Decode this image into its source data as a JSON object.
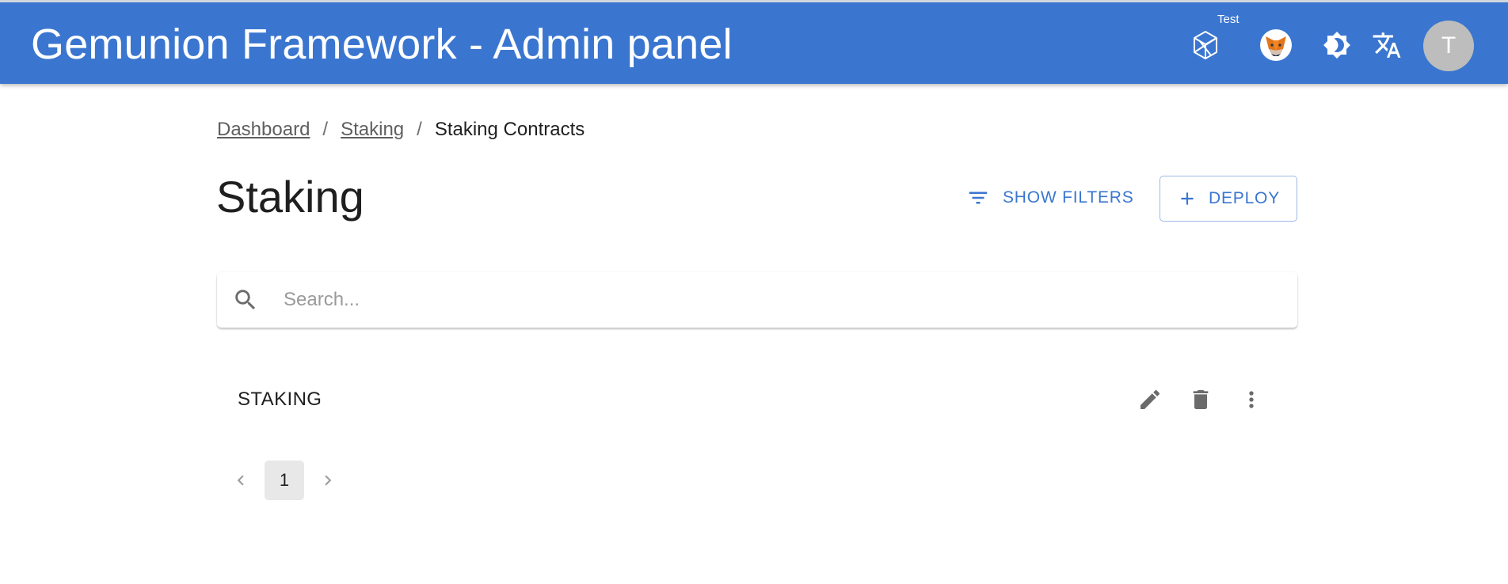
{
  "appbar": {
    "title": "Gemunion Framework - Admin panel",
    "network_label": "Test",
    "avatar_letter": "T",
    "color": "#3a76d0",
    "icons": [
      "network-icon",
      "metamask-fox-icon",
      "brightness-icon",
      "translate-icon"
    ]
  },
  "breadcrumb": {
    "items": [
      "Dashboard",
      "Staking",
      "Staking Contracts"
    ],
    "separator": "/"
  },
  "page": {
    "title": "Staking",
    "show_filters_label": "SHOW FILTERS",
    "deploy_label": "DEPLOY"
  },
  "search": {
    "placeholder": "Search...",
    "value": ""
  },
  "list": {
    "items": [
      {
        "label": "STAKING",
        "actions": [
          "edit-icon",
          "delete-icon",
          "more-vert-icon"
        ]
      }
    ]
  },
  "pagination": {
    "current_page": "1"
  }
}
